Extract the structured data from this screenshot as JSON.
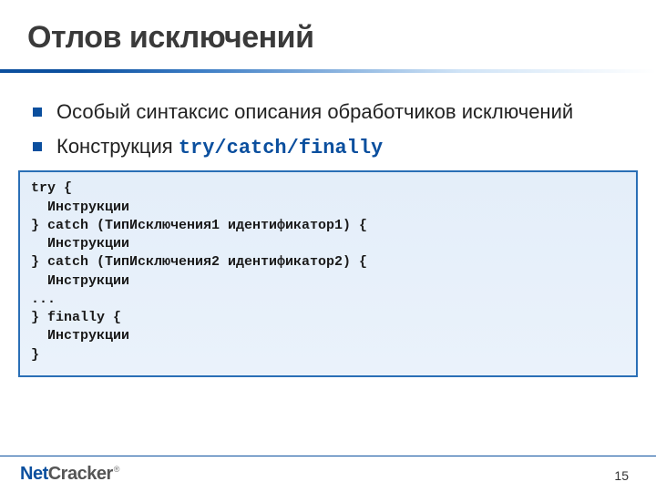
{
  "title": "Отлов исключений",
  "bullets": [
    {
      "text": "Особый синтаксис описания обработчиков исключений"
    },
    {
      "prefix": "Конструкция ",
      "code": "try/catch/finally"
    }
  ],
  "code": "try {\n  Инструкции\n} catch (ТипИсключения1 идентификатор1) {\n  Инструкции\n} catch (ТипИсключения2 идентификатор2) {\n  Инструкции\n...\n} finally {\n  Инструкции\n}",
  "logo": {
    "part1": "Net",
    "part2": "Cracker",
    "reg": "®"
  },
  "page": "15"
}
